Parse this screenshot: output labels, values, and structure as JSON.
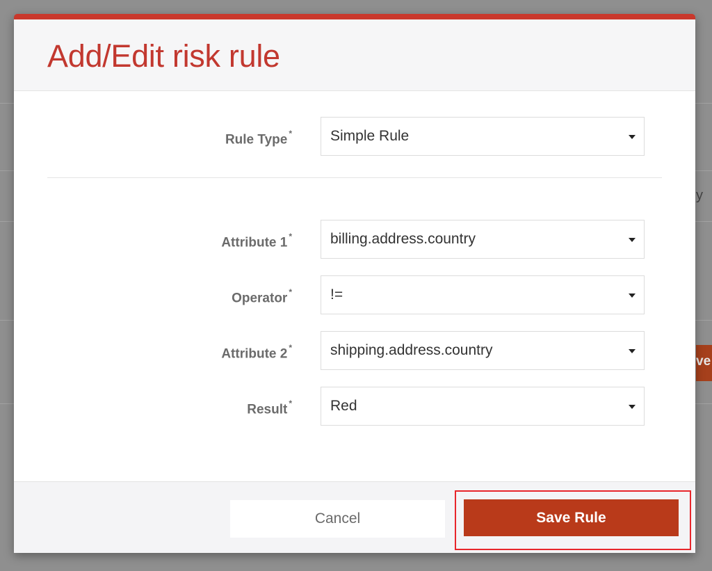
{
  "background": {
    "partial_text": "y",
    "partial_button_text": "ve"
  },
  "modal": {
    "title": "Add/Edit risk rule",
    "accent_color": "#c9382c",
    "fields": [
      {
        "label": "Rule Type",
        "required_mark": "*",
        "value": "Simple Rule"
      },
      {
        "label": "Attribute 1",
        "required_mark": "*",
        "value": "billing.address.country"
      },
      {
        "label": "Operator",
        "required_mark": "*",
        "value": "!="
      },
      {
        "label": "Attribute 2",
        "required_mark": "*",
        "value": "shipping.address.country"
      },
      {
        "label": "Result",
        "required_mark": "*",
        "value": "Red"
      }
    ],
    "footer": {
      "cancel_label": "Cancel",
      "save_label": "Save Rule",
      "save_color": "#b93a1a",
      "highlight_color": "#e8262b"
    }
  }
}
